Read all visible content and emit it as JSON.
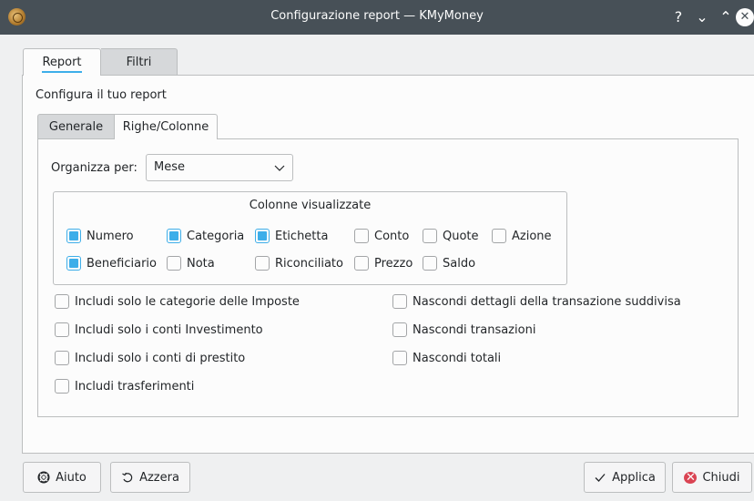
{
  "window": {
    "title": "Configurazione report — KMyMoney",
    "help_glyph": "?",
    "minimize_glyph": "⌄",
    "maximize_glyph": "⌃",
    "close_glyph": "✕"
  },
  "outer_tabs": [
    {
      "label": "Report",
      "active": true
    },
    {
      "label": "Filtri",
      "active": false
    }
  ],
  "configure_label": "Configura il tuo report",
  "inner_tabs": [
    {
      "label": "Generale",
      "active": false
    },
    {
      "label": "Righe/Colonne",
      "active": true
    }
  ],
  "organize": {
    "label": "Organizza per:",
    "value": "Mese"
  },
  "columns_group": {
    "title": "Colonne visualizzate",
    "items": [
      {
        "label": "Numero",
        "checked": true
      },
      {
        "label": "Categoria",
        "checked": true
      },
      {
        "label": "Etichetta",
        "checked": true
      },
      {
        "label": "Conto",
        "checked": false
      },
      {
        "label": "Quote",
        "checked": false
      },
      {
        "label": "Azione",
        "checked": false
      },
      {
        "label": "Beneficiario",
        "checked": true
      },
      {
        "label": "Nota",
        "checked": false
      },
      {
        "label": "Riconciliato",
        "checked": false
      },
      {
        "label": "Prezzo",
        "checked": false
      },
      {
        "label": "Saldo",
        "checked": false
      }
    ]
  },
  "options_left": [
    {
      "label": "Includi solo le categorie delle Imposte",
      "checked": false
    },
    {
      "label": "Includi solo i conti Investimento",
      "checked": false
    },
    {
      "label": "Includi solo i conti di prestito",
      "checked": false
    },
    {
      "label": "Includi trasferimenti",
      "checked": false
    }
  ],
  "options_right": [
    {
      "label": "Nascondi dettagli della transazione suddivisa",
      "checked": false
    },
    {
      "label": "Nascondi transazioni",
      "checked": false
    },
    {
      "label": "Nascondi totali",
      "checked": false
    }
  ],
  "footer": {
    "help_label": "Aiuto",
    "reset_label": "Azzera",
    "apply_label": "Applica",
    "close_label": "Chiudi"
  },
  "colors": {
    "titlebar": "#475057",
    "accent": "#3daee9",
    "close_red": "#da4453"
  }
}
